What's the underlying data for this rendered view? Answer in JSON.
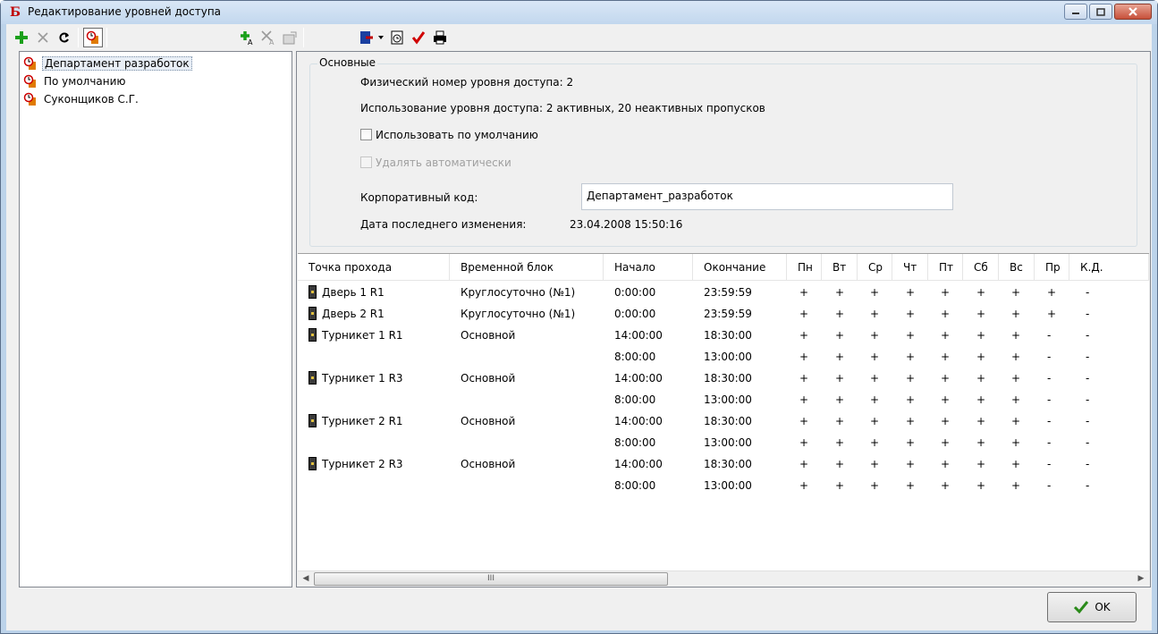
{
  "window": {
    "title": "Редактирование уровней доступа",
    "app_icon_glyph": "Б"
  },
  "toolbar": {
    "buttons": [
      {
        "name": "add-icon",
        "color": "#1aa01a"
      },
      {
        "name": "delete-icon",
        "color": "#9a9a9a"
      },
      {
        "name": "refresh-icon",
        "color": "#000000"
      },
      {
        "name": "access-level-icon",
        "color": "#e07a00"
      },
      {
        "name": "add-point-icon",
        "color": "#1aa01a"
      },
      {
        "name": "delete-point-icon",
        "color": "#9a9a9a"
      },
      {
        "name": "properties-icon",
        "color": "#9a9a9a"
      },
      {
        "name": "export-icon",
        "color": "#1a3fa0"
      },
      {
        "name": "schedule-icon",
        "color": "#000000"
      },
      {
        "name": "check-icon",
        "color": "#d00000"
      },
      {
        "name": "print-icon",
        "color": "#000000"
      }
    ]
  },
  "tree": {
    "items": [
      {
        "label": "Департамент разработок",
        "selected": true
      },
      {
        "label": "По умолчанию",
        "selected": false
      },
      {
        "label": "Суконщиков С.Г.",
        "selected": false
      }
    ]
  },
  "details": {
    "group_title": "Основные",
    "physical_number": "Физический номер уровня доступа: 2",
    "usage": "Использование уровня доступа: 2 активных, 20 неактивных пропусков",
    "use_default_label": "Использовать по умолчанию",
    "auto_delete_label": "Удалять автоматически",
    "corp_code_label": "Корпоративный код:",
    "corp_code_value": "Департамент_разработок",
    "last_modified_label": "Дата последнего изменения:",
    "last_modified_value": "23.04.2008 15:50:16"
  },
  "grid": {
    "columns": [
      "Точка прохода",
      "Временной блок",
      "Начало",
      "Окончание",
      "Пн",
      "Вт",
      "Ср",
      "Чт",
      "Пт",
      "Сб",
      "Вс",
      "Пр",
      "К.Д."
    ],
    "rows": [
      {
        "point": "Дверь 1 R1",
        "block": "Круглосуточно (№1)",
        "start": "0:00:00",
        "end": "23:59:59",
        "days": [
          "+",
          "+",
          "+",
          "+",
          "+",
          "+",
          "+",
          "+",
          "-"
        ]
      },
      {
        "point": "Дверь 2 R1",
        "block": "Круглосуточно (№1)",
        "start": "0:00:00",
        "end": "23:59:59",
        "days": [
          "+",
          "+",
          "+",
          "+",
          "+",
          "+",
          "+",
          "+",
          "-"
        ]
      },
      {
        "point": "Турникет 1 R1",
        "block": "Основной",
        "start": "14:00:00",
        "end": "18:30:00",
        "days": [
          "+",
          "+",
          "+",
          "+",
          "+",
          "+",
          "+",
          "-",
          "-"
        ]
      },
      {
        "point": "",
        "block": "",
        "start": "8:00:00",
        "end": "13:00:00",
        "days": [
          "+",
          "+",
          "+",
          "+",
          "+",
          "+",
          "+",
          "-",
          "-"
        ]
      },
      {
        "point": "Турникет 1 R3",
        "block": "Основной",
        "start": "14:00:00",
        "end": "18:30:00",
        "days": [
          "+",
          "+",
          "+",
          "+",
          "+",
          "+",
          "+",
          "-",
          "-"
        ]
      },
      {
        "point": "",
        "block": "",
        "start": "8:00:00",
        "end": "13:00:00",
        "days": [
          "+",
          "+",
          "+",
          "+",
          "+",
          "+",
          "+",
          "-",
          "-"
        ]
      },
      {
        "point": "Турникет 2 R1",
        "block": "Основной",
        "start": "14:00:00",
        "end": "18:30:00",
        "days": [
          "+",
          "+",
          "+",
          "+",
          "+",
          "+",
          "+",
          "-",
          "-"
        ]
      },
      {
        "point": "",
        "block": "",
        "start": "8:00:00",
        "end": "13:00:00",
        "days": [
          "+",
          "+",
          "+",
          "+",
          "+",
          "+",
          "+",
          "-",
          "-"
        ]
      },
      {
        "point": "Турникет 2 R3",
        "block": "Основной",
        "start": "14:00:00",
        "end": "18:30:00",
        "days": [
          "+",
          "+",
          "+",
          "+",
          "+",
          "+",
          "+",
          "-",
          "-"
        ]
      },
      {
        "point": "",
        "block": "",
        "start": "8:00:00",
        "end": "13:00:00",
        "days": [
          "+",
          "+",
          "+",
          "+",
          "+",
          "+",
          "+",
          "-",
          "-"
        ]
      }
    ],
    "scroll_thumb_glyph": "III"
  },
  "footer": {
    "ok_label": "OK"
  }
}
